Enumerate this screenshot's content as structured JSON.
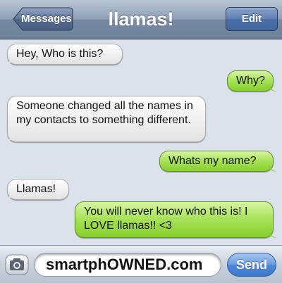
{
  "header": {
    "back_label": "Messages",
    "title": "llamas!",
    "edit_label": "Edit"
  },
  "messages": [
    {
      "direction": "incoming",
      "text": "Hey, Who is this?"
    },
    {
      "direction": "outgoing",
      "text": "Why?"
    },
    {
      "direction": "incoming",
      "text": "Someone changed all the names in my contacts to something different."
    },
    {
      "direction": "outgoing",
      "text": "Whats my name?"
    },
    {
      "direction": "incoming",
      "text": "Llamas!"
    },
    {
      "direction": "outgoing",
      "text": "You will never know who this is! I LOVE llamas!! <3"
    }
  ],
  "input": {
    "value": "smartphOWNED.com",
    "send_label": "Send",
    "camera_icon": "camera-icon"
  },
  "colors": {
    "incoming_bubble": "#f1f1f1",
    "outgoing_bubble": "#a9e35b",
    "header": "#7688a1",
    "send_button": "#4f86d6"
  }
}
